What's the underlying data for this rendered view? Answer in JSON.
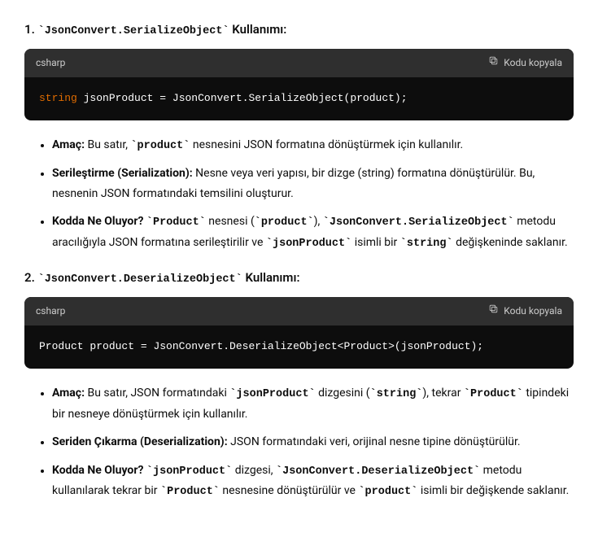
{
  "sections": [
    {
      "number": "1.",
      "title_code": "JsonConvert.SerializeObject",
      "title_suffix": " Kullanımı:",
      "code": {
        "lang": "csharp",
        "copy_label": "Kodu kopyala",
        "tokens": [
          {
            "t": "type",
            "v": "string"
          },
          {
            "t": "sp",
            " ": " "
          },
          {
            "t": "id",
            "v": "jsonProduct"
          },
          {
            "t": "sp",
            " ": " "
          },
          {
            "t": "op",
            "v": "="
          },
          {
            "t": "sp",
            " ": " "
          },
          {
            "t": "id",
            "v": "JsonConvert.SerializeObject(product);"
          }
        ]
      },
      "bullets": [
        {
          "parts": [
            {
              "b": true,
              "v": "Amaç:"
            },
            {
              "v": " Bu satır, "
            },
            {
              "c": true,
              "v": "`product`"
            },
            {
              "v": " nesnesini JSON formatına dönüştürmek için kullanılır."
            }
          ]
        },
        {
          "parts": [
            {
              "b": true,
              "v": "Serileştirme (Serialization):"
            },
            {
              "v": " Nesne veya veri yapısı, bir dizge (string) formatına dönüştürülür. Bu, nesnenin JSON formatındaki temsilini oluşturur."
            }
          ]
        },
        {
          "parts": [
            {
              "b": true,
              "v": "Kodda Ne Oluyor?"
            },
            {
              "v": " "
            },
            {
              "c": true,
              "v": "`Product`"
            },
            {
              "v": " nesnesi ("
            },
            {
              "c": true,
              "v": "`product`"
            },
            {
              "v": "), "
            },
            {
              "c": true,
              "v": "`JsonConvert.SerializeObject`"
            },
            {
              "v": " metodu aracılığıyla JSON formatına serileştirilir ve "
            },
            {
              "c": true,
              "v": "`jsonProduct`"
            },
            {
              "v": " isimli bir "
            },
            {
              "c": true,
              "v": "`string`"
            },
            {
              "v": " değişkeninde saklanır."
            }
          ]
        }
      ]
    },
    {
      "number": "2.",
      "title_code": "JsonConvert.DeserializeObject",
      "title_suffix": " Kullanımı:",
      "code": {
        "lang": "csharp",
        "copy_label": "Kodu kopyala",
        "tokens": [
          {
            "t": "id",
            "v": "Product product "
          },
          {
            "t": "op",
            "v": "="
          },
          {
            "t": "id",
            "v": " JsonConvert.DeserializeObject<Product>(jsonProduct);"
          }
        ]
      },
      "bullets": [
        {
          "parts": [
            {
              "b": true,
              "v": "Amaç:"
            },
            {
              "v": " Bu satır, JSON formatındaki "
            },
            {
              "c": true,
              "v": "`jsonProduct`"
            },
            {
              "v": " dizgesini ("
            },
            {
              "c": true,
              "v": "`string`"
            },
            {
              "v": "), tekrar "
            },
            {
              "c": true,
              "v": "`Product`"
            },
            {
              "v": " tipindeki bir nesneye dönüştürmek için kullanılır."
            }
          ]
        },
        {
          "parts": [
            {
              "b": true,
              "v": "Seriden Çıkarma (Deserialization):"
            },
            {
              "v": " JSON formatındaki veri, orijinal nesne tipine dönüştürülür."
            }
          ]
        },
        {
          "parts": [
            {
              "b": true,
              "v": "Kodda Ne Oluyor?"
            },
            {
              "v": " "
            },
            {
              "c": true,
              "v": "`jsonProduct`"
            },
            {
              "v": " dizgesi, "
            },
            {
              "c": true,
              "v": "`JsonConvert.DeserializeObject`"
            },
            {
              "v": " metodu kullanılarak tekrar bir "
            },
            {
              "c": true,
              "v": "`Product`"
            },
            {
              "v": " nesnesine dönüştürülür ve "
            },
            {
              "c": true,
              "v": "`product`"
            },
            {
              "v": " isimli bir değişkende saklanır."
            }
          ]
        }
      ]
    }
  ]
}
